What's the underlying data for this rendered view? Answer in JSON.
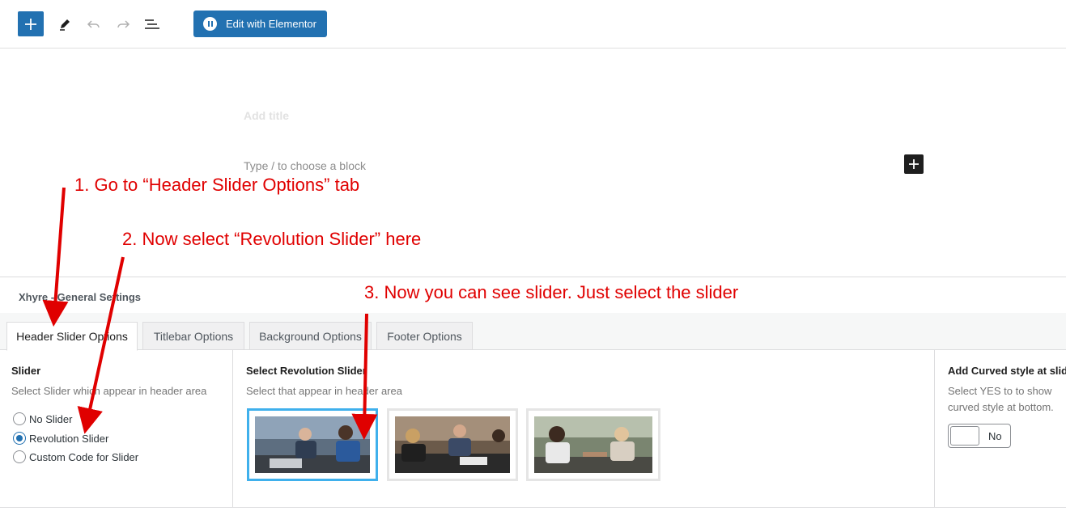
{
  "toolbar": {
    "edit_with_elementor": "Edit with Elementor",
    "icons": [
      "plus-icon",
      "pencil-icon",
      "undo-icon",
      "redo-icon",
      "list-view-icon"
    ]
  },
  "editor": {
    "title_placeholder": "Add title",
    "block_placeholder": "Type / to choose a block"
  },
  "annotations": {
    "step1": "1. Go to “Header Slider Options” tab",
    "step2": "2. Now select “Revolution Slider” here",
    "step3": "3. Now you can see slider. Just select the slider"
  },
  "metabox": {
    "title": "Xhyre - General Settings",
    "tabs": [
      {
        "label": "Header Slider Options",
        "active": true
      },
      {
        "label": "Titlebar Options",
        "active": false
      },
      {
        "label": "Background Options",
        "active": false
      },
      {
        "label": "Footer Options",
        "active": false
      }
    ],
    "slider": {
      "label": "Slider",
      "description": "Select Slider which appear in header area",
      "options": [
        {
          "label": "No Slider",
          "checked": false
        },
        {
          "label": "Revolution Slider",
          "checked": true
        },
        {
          "label": "Custom Code for Slider",
          "checked": false
        }
      ]
    },
    "revolution": {
      "label": "Select Revolution Slider",
      "description": "Select that appear in header area",
      "selected_index": 0
    },
    "curved": {
      "label": "Add Curved style at slider",
      "description": "Select YES to to show curved style at bottom.",
      "toggle_label": "No"
    }
  },
  "colors": {
    "accent": "#2271b1",
    "annotation": "#e00000",
    "selected_thumb": "#3fb0ec"
  }
}
